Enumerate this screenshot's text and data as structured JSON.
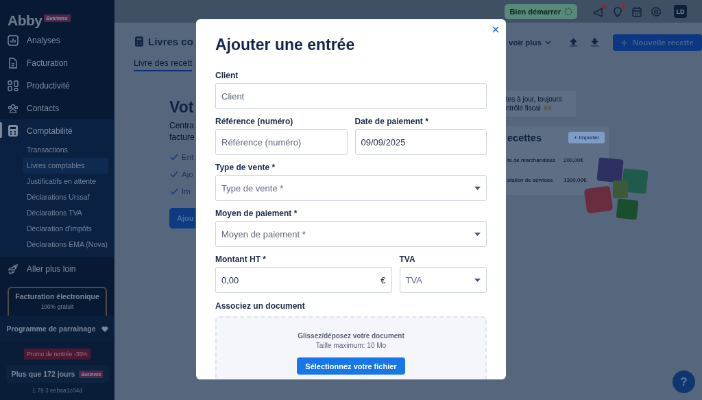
{
  "sidebar": {
    "logo": "Abby",
    "logo_badge": "Business",
    "nav": [
      {
        "label": "Analyses",
        "selected": false
      },
      {
        "label": "Facturation",
        "selected": false
      },
      {
        "label": "Productivité",
        "selected": false
      },
      {
        "label": "Contacts",
        "selected": false
      },
      {
        "label": "Comptabilité",
        "selected": true,
        "children": [
          {
            "label": "Transactions",
            "selected": false
          },
          {
            "label": "Livres comptables",
            "selected": true
          },
          {
            "label": "Justificatifs en attente",
            "selected": false
          },
          {
            "label": "Déclarations Urssaf",
            "selected": false
          },
          {
            "label": "Déclarations TVA",
            "selected": false
          },
          {
            "label": "Déclaration d'impôts",
            "selected": false
          },
          {
            "label": "Déclarations EMA (Nova)",
            "selected": false
          }
        ]
      },
      {
        "label": "Aller plus loin",
        "selected": false
      }
    ],
    "promo_card": {
      "title": "Facturation électronique",
      "subtitle": "100% gratuit"
    },
    "referral": "Programme de parrainage",
    "promo_badge": "Promo de rentrée -35%",
    "trial": {
      "label": "Plus que 172 jours",
      "badge": "Business"
    },
    "version": "1.79.3 eebaa1c04d"
  },
  "topbar": {
    "getting_started": "Bien démarrer",
    "icons": [
      {
        "kind": "megaphone",
        "dot": true
      },
      {
        "kind": "bulb",
        "dot": true
      },
      {
        "kind": "calendar",
        "dot": false
      },
      {
        "kind": "gear",
        "dot": false
      }
    ],
    "avatar": "LD"
  },
  "page": {
    "title": "Livres co",
    "tabs": [
      {
        "label": "Livre des recett",
        "selected": true
      }
    ],
    "hero": {
      "heading": "Vot",
      "lines": [
        "Centra",
        "facture"
      ],
      "checks": [
        "Ent",
        "Ajo",
        "Im"
      ],
      "button": "Ajou"
    },
    "more": "voir plus",
    "new_button": "Nouvelle recette",
    "promo_text": [
      "tes à jour, toujours",
      "ntrôle fiscal"
    ],
    "preview": {
      "title": "ecettes",
      "import": "+ Importer",
      "rows": [
        {
          "label": "te de marchandises",
          "amount": "200,00€"
        },
        {
          "label": "station de services",
          "amount": "1300,00€"
        }
      ]
    }
  },
  "modal": {
    "title": "Ajouter une entrée",
    "rows": [
      [
        {
          "kind": "text",
          "label": "Client",
          "placeholder": "Client"
        }
      ],
      [
        {
          "kind": "text",
          "label": "Référence (numéro)",
          "placeholder": "Référence (numéro)"
        },
        {
          "kind": "text",
          "label": "Date de paiement *",
          "value": "09/09/2025"
        }
      ],
      [
        {
          "kind": "select",
          "label": "Type de vente *",
          "placeholder": "Type de vente *"
        }
      ],
      [
        {
          "kind": "select",
          "label": "Moyen de paiement *",
          "placeholder": "Moyen de paiement *"
        }
      ],
      [
        {
          "kind": "amount",
          "label": "Montant HT *",
          "value": "0,00",
          "suffix": "€"
        },
        {
          "kind": "select",
          "label": "TVA",
          "placeholder": "TVA"
        }
      ]
    ],
    "upload": {
      "label": "Associez un document",
      "hint": "Glissez/déposez votre document",
      "limit": "Taille maximum: 10 Mo",
      "button": "Sélectionnez votre fichier"
    }
  },
  "help": "?"
}
